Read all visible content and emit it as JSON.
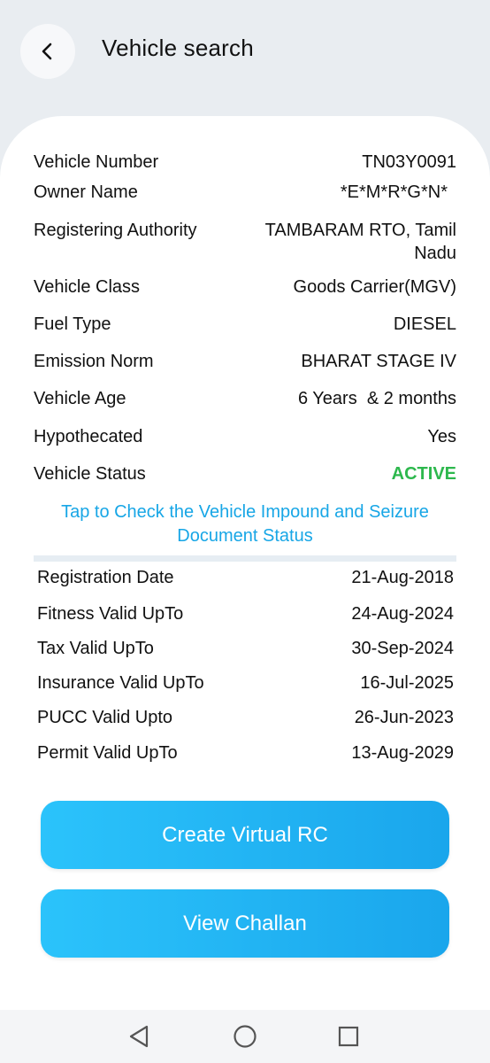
{
  "header": {
    "title": "Vehicle search",
    "back_icon": "chevron-left-icon"
  },
  "details": [
    {
      "label": "Vehicle Number",
      "value": "TN03Y0091"
    },
    {
      "label": "Owner Name",
      "value": "*E*M*R*G*N*"
    },
    {
      "label": "Registering Authority",
      "value": "TAMBARAM RTO, Tamil Nadu"
    },
    {
      "label": "Vehicle Class",
      "value": "Goods Carrier(MGV)"
    },
    {
      "label": "Fuel Type",
      "value": "DIESEL"
    },
    {
      "label": "Emission Norm",
      "value": "BHARAT STAGE IV"
    },
    {
      "label": "Vehicle Age",
      "value": "6 Years  & 2 months"
    },
    {
      "label": "Hypothecated",
      "value": "Yes"
    },
    {
      "label": "Vehicle Status",
      "value": "ACTIVE"
    }
  ],
  "impound_link": "Tap to Check the Vehicle Impound and Seizure Document Status",
  "validity": [
    {
      "label": "Registration Date",
      "value": "21-Aug-2018"
    },
    {
      "label": "Fitness Valid UpTo",
      "value": "24-Aug-2024"
    },
    {
      "label": "Tax Valid UpTo",
      "value": "30-Sep-2024"
    },
    {
      "label": "Insurance Valid UpTo",
      "value": "16-Jul-2025"
    },
    {
      "label": "PUCC Valid Upto",
      "value": "26-Jun-2023"
    },
    {
      "label": "Permit Valid UpTo",
      "value": "13-Aug-2029"
    }
  ],
  "buttons": {
    "virtual_rc": "Create Virtual RC",
    "view_challan": "View Challan"
  },
  "navbar": {
    "back": "triangle-back-icon",
    "home": "circle-home-icon",
    "recents": "square-recents-icon"
  },
  "colors": {
    "accent": "#17a6e6",
    "status_active": "#2db84d",
    "button_start": "#2bc3fb",
    "button_end": "#1aa6ec"
  }
}
